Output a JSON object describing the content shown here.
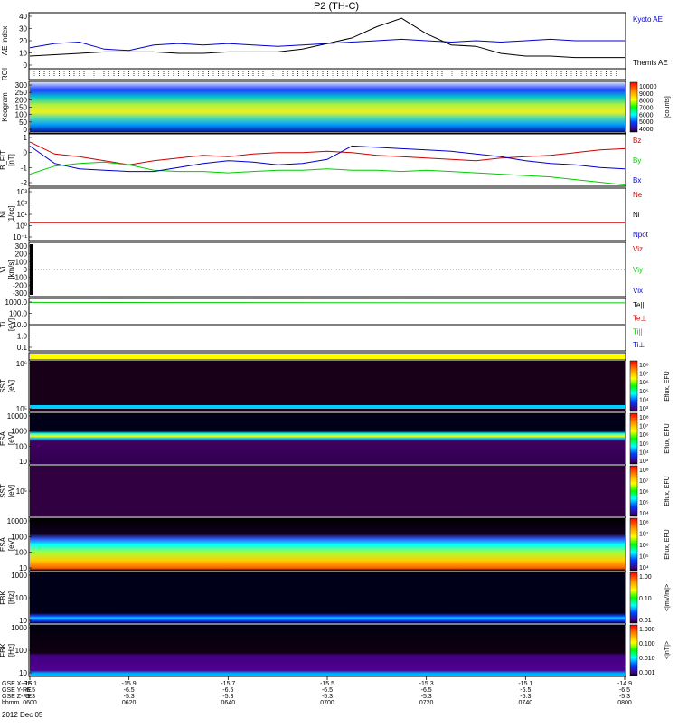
{
  "title": "P2 (TH-C)",
  "date_label": "2012 Dec 05",
  "ephemeris_labels": [
    "GSE X-RE",
    "GSE Y-RE",
    "GSE Z-RE",
    "hhmm"
  ],
  "time_ticks": [
    {
      "x": "-15.1",
      "y": "-6.5",
      "z": "-5.3",
      "t": "0600"
    },
    {
      "x": "-15.9",
      "y": "-6.5",
      "z": "-5.3",
      "t": "0620"
    },
    {
      "x": "-15.7",
      "y": "-6.5",
      "z": "-5.3",
      "t": "0640"
    },
    {
      "x": "-15.5",
      "y": "-6.5",
      "z": "-5.3",
      "t": "0700"
    },
    {
      "x": "-15.3",
      "y": "-6.5",
      "z": "-5.3",
      "t": "0720"
    },
    {
      "x": "-15.1",
      "y": "-6.5",
      "z": "-5.3",
      "t": "0740"
    },
    {
      "x": "-14.9",
      "y": "-6.5",
      "z": "-5.3",
      "t": "0800"
    }
  ],
  "panels": {
    "ae": {
      "ylabel": "AE Index",
      "ticks": [
        "40",
        "30",
        "20",
        "10",
        "0"
      ],
      "legend": [
        {
          "label": "Kyoto AE",
          "color": "#0000cc"
        },
        {
          "label": "Themis AE",
          "color": "#000000"
        }
      ]
    },
    "roi": {
      "ylabel": "ROI"
    },
    "keogram": {
      "ylabel": "Keogram",
      "ticks": [
        "300",
        "250",
        "200",
        "150",
        "100",
        "50",
        "0"
      ],
      "colorbar_ticks": [
        "10000",
        "9000",
        "8000",
        "7000",
        "6000",
        "5000",
        "4000"
      ],
      "colorbar_label": "[counts]"
    },
    "bfield": {
      "ylabel": [
        "B_FIT",
        "[nT]"
      ],
      "ticks": [
        "1",
        "0",
        "-1",
        "-2"
      ],
      "legend": [
        {
          "label": "Bz",
          "color": "#cc0000"
        },
        {
          "label": "By",
          "color": "#00cc00"
        },
        {
          "label": "Bx",
          "color": "#0000cc"
        }
      ]
    },
    "density": {
      "ylabel": [
        "Ni",
        "[1/cc]"
      ],
      "ticks": [
        "10³",
        "10²",
        "10¹",
        "10⁰",
        "10⁻¹"
      ],
      "legend": [
        {
          "label": "Ne",
          "color": "#cc0000"
        },
        {
          "label": "Ni",
          "color": "#000000"
        },
        {
          "label": "Npot",
          "color": "#0000cc"
        }
      ]
    },
    "velocity": {
      "ylabel": [
        "Vi",
        "[km/s]"
      ],
      "ticks": [
        "300",
        "200",
        "100",
        "0",
        "-100",
        "-200",
        "-300"
      ],
      "legend": [
        {
          "label": "Viz",
          "color": "#cc0000"
        },
        {
          "label": "Viy",
          "color": "#00cc00"
        },
        {
          "label": "Vix",
          "color": "#0000cc"
        }
      ]
    },
    "temperature": {
      "ylabel": [
        "Ti",
        "[eV]"
      ],
      "ticks": [
        "1000.0",
        "100.0",
        "10.0",
        "1.0",
        "0.1"
      ],
      "legend": [
        {
          "label": "Te||",
          "color": "#000000"
        },
        {
          "label": "Te⊥",
          "color": "#cc0000"
        },
        {
          "label": "Ti||",
          "color": "#00cc00"
        },
        {
          "label": "Ti⊥",
          "color": "#0000cc"
        }
      ]
    },
    "sst_e": {
      "ylabel": [
        "SST",
        "[eV]"
      ],
      "ticks": [
        "10⁶",
        "10⁵"
      ],
      "colorbar_ticks": [
        "10⁸",
        "10⁷",
        "10⁶",
        "10⁵",
        "10⁴",
        "10³"
      ],
      "colorbar_label": "Eflux, EFU"
    },
    "esa_e": {
      "ylabel": [
        "ESA",
        "[eV]"
      ],
      "ticks": [
        "10000",
        "1000",
        "100",
        "10"
      ],
      "colorbar_ticks": [
        "10⁸",
        "10⁷",
        "10⁶",
        "10⁵",
        "10⁴",
        "10³"
      ],
      "colorbar_label": "Eflux, EFU"
    },
    "sst_i": {
      "ylabel": [
        "SST",
        "[eV]"
      ],
      "ticks": [
        "10⁵"
      ],
      "colorbar_ticks": [
        "10⁸",
        "10⁷",
        "10⁶",
        "10⁵",
        "10⁴"
      ],
      "colorbar_label": "Eflux, EFU"
    },
    "esa_i": {
      "ylabel": [
        "ESA",
        "[eV]"
      ],
      "ticks": [
        "10000",
        "1000",
        "100",
        "10"
      ],
      "colorbar_ticks": [
        "10⁸",
        "10⁷",
        "10⁶",
        "10⁵",
        "10⁴"
      ],
      "colorbar_label": "Eflux, EFU"
    },
    "fbk_e": {
      "ylabel": [
        "FBK",
        "[Hz]"
      ],
      "ticks": [
        "1000",
        "100",
        "10"
      ],
      "colorbar_ticks": [
        "1.00",
        "0.10",
        "0.01"
      ],
      "colorbar_label": "<|mV/m|>"
    },
    "fbk_b": {
      "ylabel": [
        "FBK",
        "[Hz]"
      ],
      "ticks": [
        "1000",
        "100",
        "10"
      ],
      "colorbar_ticks": [
        "1.000",
        "0.100",
        "0.010",
        "0.001"
      ],
      "colorbar_label": "<|nT|>"
    }
  },
  "chart_data": [
    {
      "type": "line",
      "name": "ae",
      "x": [
        0,
        5,
        10,
        15,
        20,
        25,
        30,
        35,
        40,
        45,
        50,
        55,
        60,
        65,
        70,
        75,
        80,
        85,
        90,
        95,
        100,
        105,
        110,
        115,
        120
      ],
      "series": [
        {
          "name": "Kyoto AE",
          "values": [
            15,
            18,
            19,
            14,
            13,
            17,
            18,
            17,
            18,
            17,
            16,
            17,
            18,
            19,
            20,
            21,
            20,
            19,
            20,
            19,
            20,
            21,
            20,
            20,
            20
          ]
        },
        {
          "name": "Themis AE",
          "values": [
            9,
            10,
            11,
            12,
            12,
            12,
            11,
            11,
            12,
            12,
            12,
            14,
            18,
            22,
            30,
            36,
            25,
            17,
            16,
            11,
            9,
            9,
            8,
            8,
            8
          ]
        }
      ],
      "ylim": [
        0,
        40
      ]
    },
    {
      "type": "line",
      "name": "bfield",
      "x": [
        0,
        5,
        10,
        15,
        20,
        25,
        30,
        35,
        40,
        45,
        50,
        55,
        60,
        65,
        70,
        75,
        80,
        85,
        90,
        95,
        100,
        105,
        110,
        115,
        120
      ],
      "series": [
        {
          "name": "Bz",
          "values": [
            0.6,
            -0.3,
            -0.5,
            -0.8,
            -1.1,
            -0.8,
            -0.6,
            -0.4,
            -0.5,
            -0.3,
            -0.2,
            -0.2,
            -0.1,
            -0.2,
            -0.4,
            -0.5,
            -0.6,
            -0.7,
            -0.8,
            -0.6,
            -0.5,
            -0.4,
            -0.2,
            0.0,
            0.1
          ]
        },
        {
          "name": "By",
          "values": [
            -1.8,
            -1.2,
            -1.0,
            -0.9,
            -1.1,
            -1.5,
            -1.6,
            -1.6,
            -1.7,
            -1.6,
            -1.5,
            -1.5,
            -1.4,
            -1.5,
            -1.5,
            -1.6,
            -1.5,
            -1.6,
            -1.7,
            -1.8,
            -1.9,
            -2.0,
            -2.2,
            -2.4,
            -2.6
          ]
        },
        {
          "name": "Bx",
          "values": [
            0.3,
            -1.0,
            -1.4,
            -1.5,
            -1.6,
            -1.6,
            -1.3,
            -1.0,
            -0.8,
            -0.9,
            -1.1,
            -1.0,
            -0.7,
            0.3,
            0.2,
            0.1,
            0.0,
            -0.1,
            -0.3,
            -0.5,
            -0.8,
            -1.0,
            -1.1,
            -1.3,
            -1.4
          ]
        }
      ],
      "ylim": [
        -2.7,
        1.2
      ]
    },
    {
      "type": "line",
      "name": "temperature",
      "x": [
        0,
        30,
        60,
        90,
        120
      ],
      "series": [
        {
          "name": "Ti||",
          "values": [
            500,
            480,
            470,
            460,
            460
          ]
        },
        {
          "name": "Te||",
          "values": [
            10,
            10,
            10,
            10,
            10
          ]
        }
      ],
      "ylim": [
        0.1,
        1000
      ]
    }
  ]
}
